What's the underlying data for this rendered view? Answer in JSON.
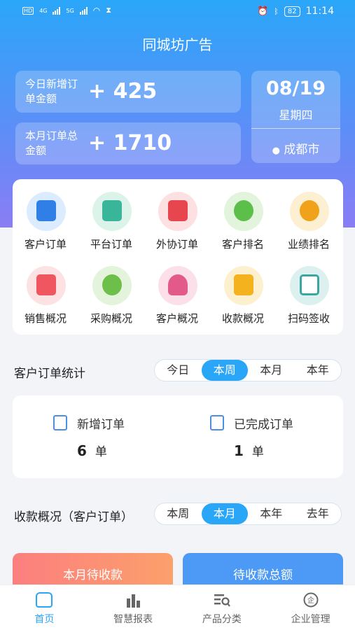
{
  "status_bar": {
    "time": "11:14",
    "battery": "82",
    "hd1": "HD",
    "hd2": "HD",
    "net1": "4G",
    "net2": "5G"
  },
  "app_title": "同城坊广告",
  "today_card": {
    "label": "今日新增订单金额",
    "value": "+ 425"
  },
  "month_card": {
    "label": "本月订单总金额",
    "value": "+ 1710"
  },
  "date_card": {
    "date": "08/19",
    "weekday": "星期四",
    "city": "成都市"
  },
  "menu": [
    {
      "label": "客户订单",
      "icon": "customer-order-icon",
      "color": "#2f7fe6"
    },
    {
      "label": "平台订单",
      "icon": "platform-order-icon",
      "color": "#39b59a"
    },
    {
      "label": "外协订单",
      "icon": "outsource-order-icon",
      "color": "#e8464f"
    },
    {
      "label": "客户排名",
      "icon": "customer-rank-icon",
      "color": "#5bbf4a"
    },
    {
      "label": "业绩排名",
      "icon": "performance-rank-icon",
      "color": "#f0a21b"
    },
    {
      "label": "销售概况",
      "icon": "sales-overview-icon",
      "color": "#ef5660"
    },
    {
      "label": "采购概况",
      "icon": "purchase-overview-icon",
      "color": "#6cc04a"
    },
    {
      "label": "客户概况",
      "icon": "customer-overview-icon",
      "color": "#e35a8a"
    },
    {
      "label": "收款概况",
      "icon": "collection-overview-icon",
      "color": "#f3b21e"
    },
    {
      "label": "扫码签收",
      "icon": "scan-sign-icon",
      "color": "#3aa8a0"
    }
  ],
  "order_stats": {
    "title": "客户订单统计",
    "tabs": [
      "今日",
      "本周",
      "本月",
      "本年"
    ],
    "active_tab": "本周",
    "new_orders": {
      "label": "新增订单",
      "count": "6",
      "unit": "单"
    },
    "done_orders": {
      "label": "已完成订单",
      "count": "1",
      "unit": "单"
    }
  },
  "collection": {
    "title": "收款概况（客户订单）",
    "tabs": [
      "本周",
      "本月",
      "本年",
      "去年"
    ],
    "active_tab": "本月",
    "pending_label": "本月待收款",
    "total_label": "待收款总额"
  },
  "tabbar": [
    {
      "label": "首页",
      "icon": "home-icon",
      "active": true
    },
    {
      "label": "智慧报表",
      "icon": "bar-chart-icon",
      "active": false
    },
    {
      "label": "产品分类",
      "icon": "product-search-icon",
      "active": false
    },
    {
      "label": "企业管理",
      "icon": "enterprise-icon",
      "active": false
    }
  ]
}
